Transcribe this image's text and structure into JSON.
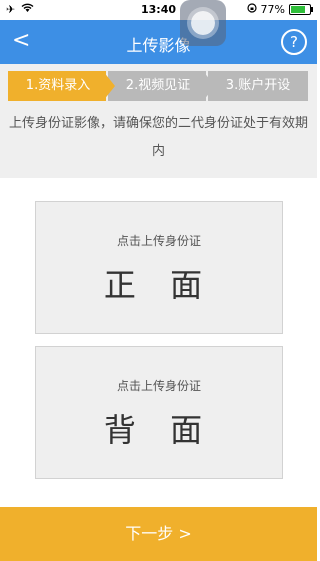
{
  "status_bar": {
    "time": "13:40",
    "battery": "77%",
    "icons": [
      "airplane-icon",
      "wifi-icon",
      "lock-rotation-icon",
      "battery-icon"
    ]
  },
  "nav": {
    "back_label": "<",
    "title": "上传影像",
    "help_label": "?"
  },
  "steps": [
    {
      "label": "1.资料录入",
      "active": true
    },
    {
      "label": "2.视频见证",
      "active": false
    },
    {
      "label": "3.账户开设",
      "active": false
    }
  ],
  "notice": "上传身份证影像，请确保您的二代身份证处于有效期内",
  "cards": {
    "front": {
      "hint": "点击上传身份证",
      "side": "正 面"
    },
    "back": {
      "hint": "点击上传身份证",
      "side": "背 面"
    }
  },
  "next_button": "下一步 >",
  "colors": {
    "nav": "#3d8fe5",
    "accent": "#f0b02c",
    "step_inactive": "#b9b9b9"
  }
}
